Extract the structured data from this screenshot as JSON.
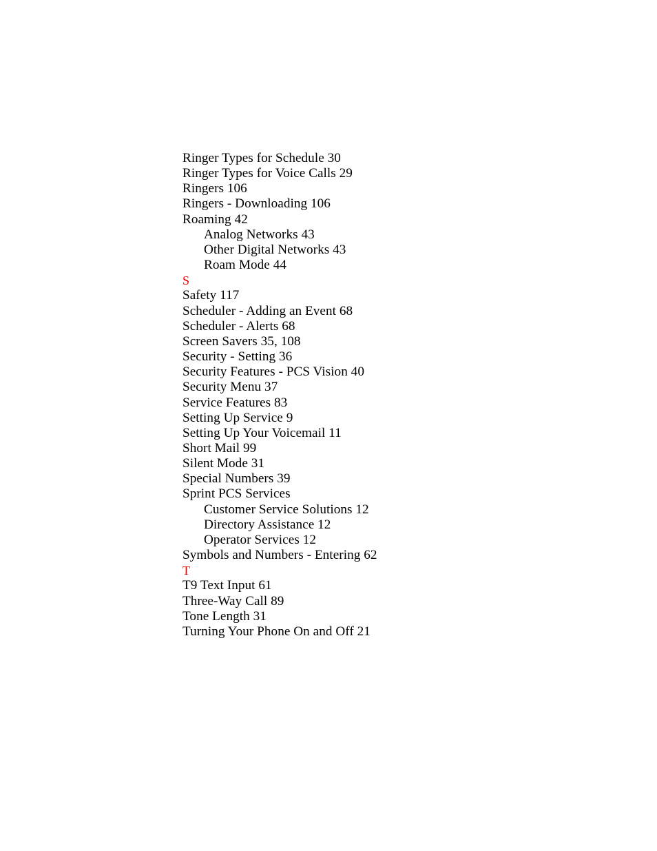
{
  "document": {
    "type": "book-index",
    "page_background": "#ffffff",
    "text_color": "#000000",
    "section_letter_color": "#ee0000"
  },
  "index": {
    "lines": [
      {
        "kind": "entry",
        "level": 0,
        "text": "Ringer Types for Schedule 30"
      },
      {
        "kind": "entry",
        "level": 0,
        "text": "Ringer Types for Voice Calls 29"
      },
      {
        "kind": "entry",
        "level": 0,
        "text": "Ringers 106"
      },
      {
        "kind": "entry",
        "level": 0,
        "text": "Ringers - Downloading 106"
      },
      {
        "kind": "entry",
        "level": 0,
        "text": "Roaming 42"
      },
      {
        "kind": "entry",
        "level": 1,
        "text": "Analog Networks 43"
      },
      {
        "kind": "entry",
        "level": 1,
        "text": "Other Digital Networks 43"
      },
      {
        "kind": "entry",
        "level": 1,
        "text": "Roam Mode 44"
      },
      {
        "kind": "section",
        "level": 0,
        "text": "S"
      },
      {
        "kind": "entry",
        "level": 0,
        "text": "Safety 117"
      },
      {
        "kind": "entry",
        "level": 0,
        "text": "Scheduler - Adding an Event 68"
      },
      {
        "kind": "entry",
        "level": 0,
        "text": "Scheduler - Alerts 68"
      },
      {
        "kind": "entry",
        "level": 0,
        "text": "Screen Savers 35, 108"
      },
      {
        "kind": "entry",
        "level": 0,
        "text": "Security - Setting 36"
      },
      {
        "kind": "entry",
        "level": 0,
        "text": "Security Features - PCS Vision 40"
      },
      {
        "kind": "entry",
        "level": 0,
        "text": "Security Menu 37"
      },
      {
        "kind": "entry",
        "level": 0,
        "text": "Service Features 83"
      },
      {
        "kind": "entry",
        "level": 0,
        "text": "Setting Up Service 9"
      },
      {
        "kind": "entry",
        "level": 0,
        "text": "Setting Up Your Voicemail 11"
      },
      {
        "kind": "entry",
        "level": 0,
        "text": "Short Mail 99"
      },
      {
        "kind": "entry",
        "level": 0,
        "text": "Silent Mode 31"
      },
      {
        "kind": "entry",
        "level": 0,
        "text": "Special Numbers 39"
      },
      {
        "kind": "entry",
        "level": 0,
        "text": "Sprint PCS Services"
      },
      {
        "kind": "entry",
        "level": 1,
        "text": "Customer Service Solutions 12"
      },
      {
        "kind": "entry",
        "level": 1,
        "text": "Directory Assistance 12"
      },
      {
        "kind": "entry",
        "level": 1,
        "text": "Operator Services 12"
      },
      {
        "kind": "entry",
        "level": 0,
        "text": "Symbols and Numbers - Entering 62"
      },
      {
        "kind": "section",
        "level": 0,
        "text": "T"
      },
      {
        "kind": "entry",
        "level": 0,
        "text": "T9 Text Input 61"
      },
      {
        "kind": "entry",
        "level": 0,
        "text": "Three-Way Call 89"
      },
      {
        "kind": "entry",
        "level": 0,
        "text": "Tone Length 31"
      },
      {
        "kind": "entry",
        "level": 0,
        "text": "Turning Your Phone On and Off 21"
      }
    ]
  }
}
